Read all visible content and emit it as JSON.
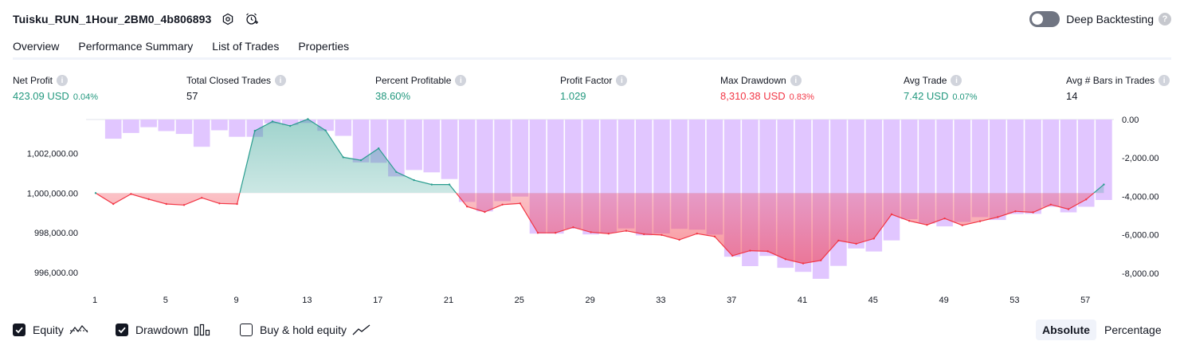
{
  "header": {
    "title": "Tuisku_RUN_1Hour_2BM0_4b806893",
    "deep_backtesting_label": "Deep Backtesting"
  },
  "tabs": [
    {
      "label": "Overview",
      "active": true
    },
    {
      "label": "Performance Summary",
      "active": false
    },
    {
      "label": "List of Trades",
      "active": false
    },
    {
      "label": "Properties",
      "active": false
    }
  ],
  "metrics": {
    "net_profit": {
      "label": "Net Profit",
      "value": "423.09 USD",
      "pct": "0.04%",
      "color": "#22987e"
    },
    "total_closed_trades": {
      "label": "Total Closed Trades",
      "value": "57"
    },
    "percent_profitable": {
      "label": "Percent Profitable",
      "value": "38.60%",
      "color": "#22987e"
    },
    "profit_factor": {
      "label": "Profit Factor",
      "value": "1.029",
      "color": "#22987e"
    },
    "max_drawdown": {
      "label": "Max Drawdown",
      "value": "8,310.38 USD",
      "pct": "0.83%",
      "color": "#f23645"
    },
    "avg_trade": {
      "label": "Avg Trade",
      "value": "7.42 USD",
      "pct": "0.07%",
      "color": "#22987e"
    },
    "avg_bars": {
      "label": "Avg # Bars in Trades",
      "value": "14"
    }
  },
  "legend": {
    "equity": {
      "label": "Equity",
      "checked": true
    },
    "drawdown": {
      "label": "Drawdown",
      "checked": true
    },
    "buy_hold": {
      "label": "Buy & hold equity",
      "checked": false
    }
  },
  "modes": {
    "absolute": "Absolute",
    "percentage": "Percentage",
    "active": "absolute"
  },
  "colors": {
    "equity_up_line": "#2a9d8f",
    "equity_down_line": "#f23645",
    "drawdown_bar": "#e1c6ff",
    "accent_green": "#22987e",
    "accent_red": "#f23645"
  },
  "chart_data": {
    "type": "area",
    "x_ticks": [
      "1",
      "5",
      "9",
      "13",
      "17",
      "21",
      "25",
      "29",
      "33",
      "37",
      "41",
      "45",
      "49",
      "53",
      "57"
    ],
    "left_axis": {
      "ticks": [
        "1,002,000.00",
        "1,000,000.00",
        "998,000.00",
        "996,000.00"
      ],
      "tick_values": [
        1002000,
        1000000,
        998000,
        996000
      ],
      "range": [
        995000,
        1003700
      ]
    },
    "right_axis": {
      "ticks": [
        "0.00",
        "-2,000.00",
        "-4,000.00",
        "-6,000.00",
        "-8,000.00"
      ],
      "tick_values": [
        0,
        -2000,
        -4000,
        -6000,
        -8000
      ],
      "range": [
        -9000,
        0
      ]
    },
    "baseline": 1000000,
    "series": [
      {
        "name": "Equity",
        "x": [
          1,
          2,
          3,
          4,
          5,
          6,
          7,
          8,
          9,
          10,
          11,
          12,
          13,
          14,
          15,
          16,
          17,
          18,
          19,
          20,
          21,
          22,
          23,
          24,
          25,
          26,
          27,
          28,
          29,
          30,
          31,
          32,
          33,
          34,
          35,
          36,
          37,
          38,
          39,
          40,
          41,
          42,
          43,
          44,
          45,
          46,
          47,
          48,
          49,
          50,
          51,
          52,
          53,
          54,
          55,
          56,
          57,
          58
        ],
        "values": [
          1000000,
          999450,
          999950,
          999690,
          999450,
          999400,
          999760,
          999480,
          999450,
          1003130,
          1003600,
          1003380,
          1003720,
          1003150,
          1001800,
          1001650,
          1002250,
          1001060,
          1000650,
          1000430,
          1000430,
          999320,
          999050,
          999420,
          999480,
          998000,
          998000,
          998280,
          998030,
          997960,
          998100,
          997930,
          997890,
          997650,
          997960,
          997810,
          996850,
          997100,
          997070,
          996670,
          996460,
          996610,
          997610,
          997450,
          997710,
          998930,
          998600,
          998400,
          998720,
          998380,
          998580,
          998790,
          999080,
          999030,
          999420,
          999190,
          999680,
          1000430
        ]
      },
      {
        "name": "Drawdown",
        "x": [
          1,
          2,
          3,
          4,
          5,
          6,
          7,
          8,
          9,
          10,
          11,
          12,
          13,
          14,
          15,
          16,
          17,
          18,
          19,
          20,
          21,
          22,
          23,
          24,
          25,
          26,
          27,
          28,
          29,
          30,
          31,
          32,
          33,
          34,
          35,
          36,
          37,
          38,
          39,
          40,
          41,
          42,
          43,
          44,
          45,
          46,
          47,
          48,
          49,
          50,
          51,
          52,
          53,
          54,
          55,
          56,
          57,
          58
        ],
        "values": [
          0,
          -1000,
          -700,
          -400,
          -600,
          -750,
          -1420,
          -560,
          -900,
          -900,
          -200,
          -280,
          -180,
          -590,
          -850,
          -2230,
          -2250,
          -2960,
          -2630,
          -2750,
          -3100,
          -4290,
          -4780,
          -4250,
          -4010,
          -5940,
          -5940,
          -5680,
          -5980,
          -5900,
          -5670,
          -6030,
          -5930,
          -5690,
          -5730,
          -5990,
          -7140,
          -7630,
          -7100,
          -7720,
          -7930,
          -8290,
          -7620,
          -6710,
          -6870,
          -6290,
          -5190,
          -5420,
          -5560,
          -5330,
          -5080,
          -5230,
          -4920,
          -4910,
          -4540,
          -4830,
          -4540,
          -4190
        ]
      }
    ]
  }
}
